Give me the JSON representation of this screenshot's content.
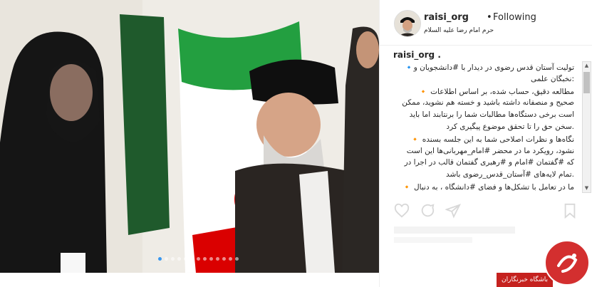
{
  "post": {
    "username": "raisi_org",
    "separator": "•",
    "follow_label": "Following",
    "location": "حرم امام رضا علیه السلام",
    "carousel": {
      "count": 13,
      "active_index": 0
    }
  },
  "caption": {
    "username": "raisi_org .",
    "lines": [
      "تولیت آستان قدس رضوی در دیدار با #دانشجویان و🔹",
      ":نخبگان علمی",
      "مطالعه دقیق، حساب شده، بر اساس اطلاعات 🔸",
      "صحیح و منصفانه داشته باشید و خسته هم نشوید، ممکن",
      "است برخی دستگاه‌ها مطالبات شما را برنتابند اما باید",
      ".سخن حق را تا تحقق موضوع پیگیری کرد",
      "نگاه‌ها و نظرات اصلاحی شما به این جلسه بسنده 🔸",
      "نشود، رویکرد ما در محضر #امام_مهربانی‌ها این است",
      "که #گفتمان #امام و #رهبری گفتمان قالب در اجرا در",
      ".تمام لایه‌های #آستان_قدس_رضوی باشد",
      "ما در تعامل با تشکل‌ها و فضای #دانشگاه ، به دنبال 🔸"
    ]
  },
  "icons": {
    "like": "heart-icon",
    "comment": "comment-icon",
    "share": "share-icon",
    "save": "bookmark-icon"
  },
  "watermark": {
    "label": "باشگاه خبرنگاران"
  },
  "colors": {
    "instagram_blue": "#3897f0",
    "badge_red": "#c5221f",
    "flag_green": "#239f40",
    "flag_red": "#da0000"
  }
}
